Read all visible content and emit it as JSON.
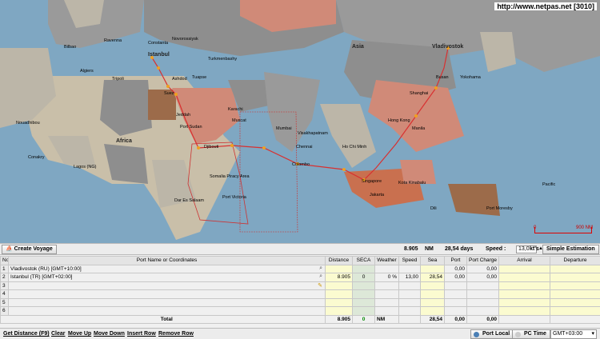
{
  "map": {
    "url_label": "http://www.netpas.net  [3010]",
    "scale_start": "0",
    "scale_end": "900 NM",
    "ports": [
      "Istanbul",
      "Vladivostok"
    ],
    "places": [
      "Bilbao",
      "Algiers",
      "Ravenna",
      "Constanta",
      "Novorossiysk",
      "Turkmenbashy",
      "Tuapse",
      "Suez",
      "Jeddah",
      "Port Sudan",
      "Djibouti",
      "Muscat",
      "Karachi",
      "Mumbai",
      "Visakhapatnam",
      "Chennai",
      "Colombo",
      "Singapore",
      "Jakarta",
      "Manila",
      "Hong Kong",
      "Shanghai",
      "Busan",
      "Yokohama",
      "Ho Chi Minh",
      "Kota Kinabalu",
      "Nouadhibou",
      "Conakry",
      "Lagos (NG)",
      "Dar Es Salaam",
      "Port Victoria",
      "Port Moresby",
      "Dili",
      "Africa",
      "Asia",
      "Somalia Piracy Area",
      "Pacific",
      "Tripoli",
      "Ashdod"
    ]
  },
  "toolbar": {
    "create_voyage": "Create Voyage",
    "distance_value": "8.905",
    "distance_unit": "NM",
    "days_value": "28,54 days",
    "speed_label": "Speed :",
    "speed_value": "13,0",
    "speed_unit": "kt's",
    "simple_estimation": "Simple Estimation"
  },
  "table": {
    "headers": [
      "No",
      "Port Name or Coordinates",
      "Distance",
      "SECA",
      "Weather",
      "Speed",
      "Sea",
      "Port",
      "Port Charge",
      "Arrival",
      "Departure"
    ],
    "rows": [
      {
        "no": "1",
        "port": "Vladivostok (RU) [GMT+10:00]",
        "distance": "",
        "seca": "",
        "weather": "",
        "speed": "",
        "sea": "",
        "port_days": "0,00",
        "charge": "0,00",
        "arrival": "",
        "departure": ""
      },
      {
        "no": "2",
        "port": "Istanbul (TR) [GMT+02:00]",
        "distance": "8.905",
        "seca": "0",
        "weather": "0 %",
        "speed": "13,00",
        "sea": "28,54",
        "port_days": "0,00",
        "charge": "0,00",
        "arrival": "",
        "departure": ""
      },
      {
        "no": "3",
        "port": "",
        "distance": "",
        "seca": "",
        "weather": "",
        "speed": "",
        "sea": "",
        "port_days": "",
        "charge": "",
        "arrival": "",
        "departure": ""
      },
      {
        "no": "4",
        "port": "",
        "distance": "",
        "seca": "",
        "weather": "",
        "speed": "",
        "sea": "",
        "port_days": "",
        "charge": "",
        "arrival": "",
        "departure": ""
      },
      {
        "no": "5",
        "port": "",
        "distance": "",
        "seca": "",
        "weather": "",
        "speed": "",
        "sea": "",
        "port_days": "",
        "charge": "",
        "arrival": "",
        "departure": ""
      },
      {
        "no": "6",
        "port": "",
        "distance": "",
        "seca": "",
        "weather": "",
        "speed": "",
        "sea": "",
        "port_days": "",
        "charge": "",
        "arrival": "",
        "departure": ""
      }
    ],
    "total": {
      "label": "Total",
      "distance": "8.905",
      "seca": "0",
      "unit": "NM",
      "sea": "28,54",
      "port_days": "0,00",
      "charge": "0,00"
    }
  },
  "bottom": {
    "get_distance": "Get Distance (F9)",
    "clear": "Clear",
    "move_up": "Move Up",
    "move_down": "Move Down",
    "insert_row": "Insert Row",
    "remove_row": "Remove Row",
    "port_local": "Port Local",
    "pc_time": "PC Time",
    "gmt_value": "GMT+03:00"
  },
  "colors": {
    "sea": "#7fa7c2",
    "route": "#d83030",
    "land_grey": "#8e8e8e",
    "land_salmon": "#d08a78",
    "yellow_cell": "#fbfbd0"
  }
}
